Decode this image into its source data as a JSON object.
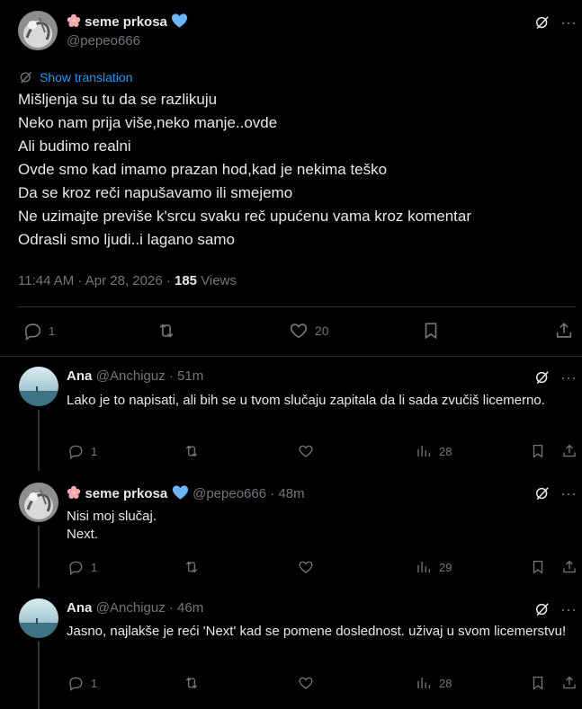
{
  "main_post": {
    "author_name": "seme prkosa",
    "handle": "@pepeo666",
    "show_translation": "Show translation",
    "body_lines": [
      "Mišljenja su tu da se razlikuju",
      "Neko nam prija više,neko manje..ovde",
      "Ali budimo realni",
      "Ovde smo kad imamo prazan hod,kad je nekima teško",
      "Da se kroz reči napušavamo ili smejemo",
      "Ne uzimajte previše k'srcu svaku reč upućenu vama kroz komentar",
      "Odrasli smo ljudi..i lagano samo"
    ],
    "timestamp": "11:44 AM · Apr 28, 2026 · ",
    "views_count": "185",
    "views_label": " Views",
    "reply_count": "1",
    "like_count": "20"
  },
  "replies": [
    {
      "author_name": "Ana",
      "handle_time": "@Anchiguz · 51m",
      "text": "Lako je to napisati, ali bih se u tvom slučaju zapitala da li sada zvučiš licemerno.",
      "reply_count": "1",
      "views": "28"
    },
    {
      "author_name": "seme prkosa",
      "handle_time": "@pepeo666 · 48m",
      "text_lines": [
        "Nisi moj slučaj.",
        "Next."
      ],
      "reply_count": "1",
      "views": "29"
    },
    {
      "author_name": "Ana",
      "handle_time": "@Anchiguz · 46m",
      "text": "Jasno, najlakše je reći 'Next' kad se pomene doslednost. uživaj u svom licemerstvu!",
      "reply_count": "1",
      "views": "28"
    }
  ],
  "colors": {
    "background": "#000000",
    "text": "#e7e9ea",
    "muted": "#71767b",
    "link": "#1d9bf0",
    "verified": "#6cb6f5",
    "divider": "#2f3336"
  },
  "icons": [
    "grok-icon",
    "more-icon",
    "translate-icon",
    "reply-icon",
    "retweet-icon",
    "like-icon",
    "bookmark-icon",
    "share-icon",
    "views-icon",
    "verified-heart-icon",
    "flower-icon"
  ]
}
